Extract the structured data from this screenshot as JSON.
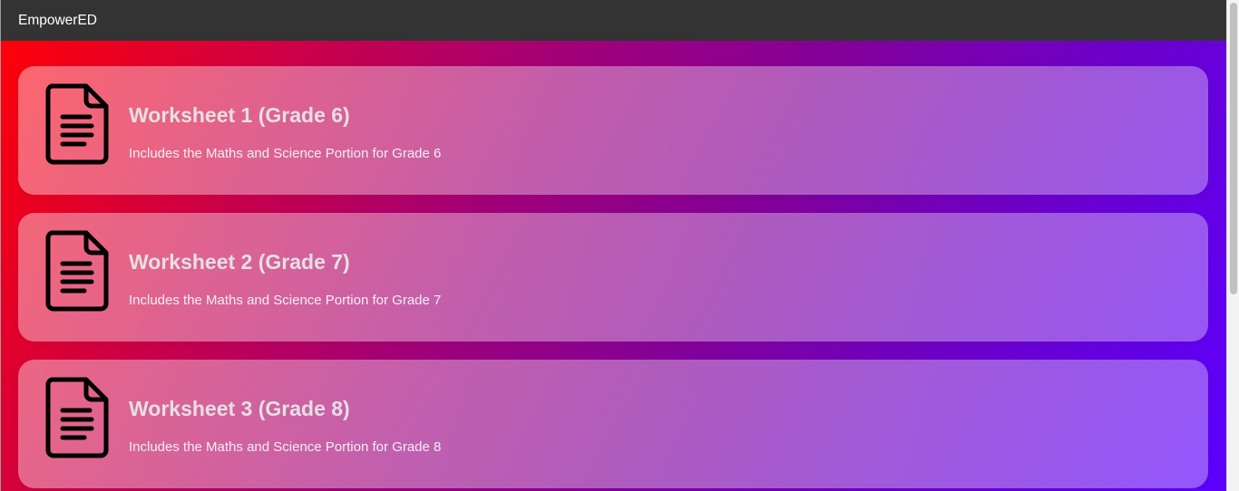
{
  "navbar": {
    "brand": "EmpowerED"
  },
  "icons": {
    "worksheet": "document-icon"
  },
  "colors": {
    "navbar_bg": "#333333",
    "gradient_start": "#ff0008",
    "gradient_end": "#5b00ff"
  },
  "worksheets": [
    {
      "title": "Worksheet 1 (Grade 6)",
      "description": "Includes the Maths and Science Portion for Grade 6"
    },
    {
      "title": "Worksheet 2 (Grade 7)",
      "description": "Includes the Maths and Science Portion for Grade 7"
    },
    {
      "title": "Worksheet 3 (Grade 8)",
      "description": "Includes the Maths and Science Portion for Grade 8"
    }
  ]
}
